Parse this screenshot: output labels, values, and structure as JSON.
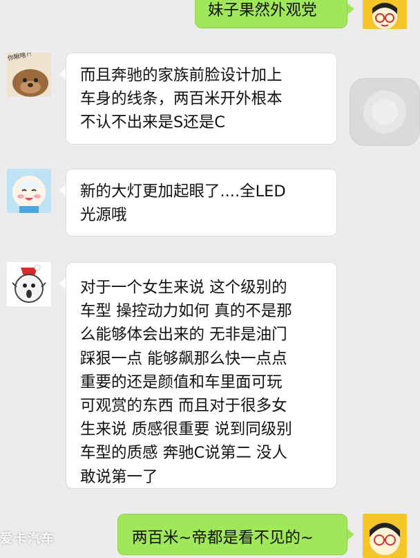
{
  "messages": [
    {
      "id": "m1",
      "direction": "outgoing",
      "text": "妹子果然外观党"
    },
    {
      "id": "m2",
      "direction": "incoming",
      "avatar_caption": "你瞅啥?!",
      "text": "而且奔驰的家族前脸设计加上\n车身的线条，两百米开外根本\n不认不出来是S还是C"
    },
    {
      "id": "m3",
      "direction": "incoming",
      "text": "新的大灯更加起眼了....全LED\n光源哦"
    },
    {
      "id": "m4",
      "direction": "incoming",
      "text": "对于一个女生来说 这个级别的\n车型 操控动力如何 真的不是那\n么能够体会出来的 无非是油门\n踩狠一点 能够飙那么快一点点\n 重要的还是颜值和车里面可玩\n可观赏的东西 而且对于很多女\n生来说 质感很重要 说到同级别\n车型的质感 奔驰C说第二 没人\n敢说第一了"
    },
    {
      "id": "m5",
      "direction": "outgoing",
      "text": "两百米~帝都是看不见的~"
    }
  ],
  "watermark": "爱卡汽车",
  "colors": {
    "background": "#ececec",
    "incoming_bubble": "#ffffff",
    "outgoing_bubble": "#a0e759"
  }
}
